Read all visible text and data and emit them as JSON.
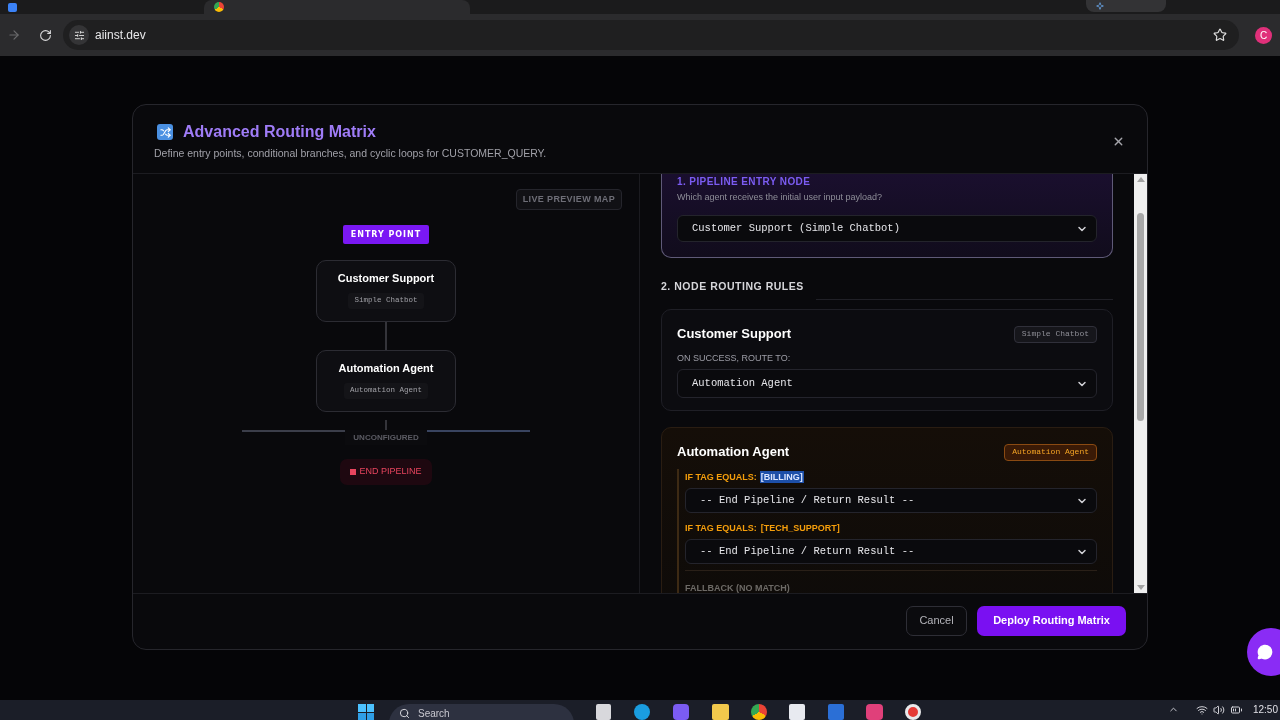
{
  "browser": {
    "url": "aiinst.dev",
    "profile_initial": "C"
  },
  "modal": {
    "title": "Advanced Routing Matrix",
    "subtitle": "Define entry points, conditional branches, and cyclic loops for CUSTOMER_QUERY.",
    "preview": {
      "badge": "LIVE PREVIEW MAP",
      "entry_label": "ENTRY POINT",
      "nodes": [
        {
          "name": "Customer Support",
          "type": "Simple Chatbot"
        },
        {
          "name": "Automation Agent",
          "type": "Automation Agent"
        }
      ],
      "branch_label": "UNCONFIGURED",
      "end_label": "END PIPELINE"
    },
    "entry_section": {
      "heading": "1. PIPELINE ENTRY NODE",
      "hint": "Which agent receives the initial user input payload?",
      "value": "Customer Support (Simple Chatbot)"
    },
    "rules_heading": "2. NODE ROUTING RULES",
    "rules": [
      {
        "kind": "success",
        "title": "Customer Support",
        "badge": "Simple Chatbot",
        "routes": [
          {
            "label": "ON SUCCESS, ROUTE TO:",
            "value": "Automation Agent"
          }
        ]
      },
      {
        "kind": "tagged",
        "title": "Automation Agent",
        "badge": "Automation Agent",
        "routes": [
          {
            "label": "IF TAG EQUALS:",
            "tag": "[BILLING]",
            "highlighted": true,
            "value": "-- End Pipeline / Return Result --"
          },
          {
            "label": "IF TAG EQUALS:",
            "tag": "[TECH_SUPPORT]",
            "highlighted": false,
            "value": "-- End Pipeline / Return Result --"
          }
        ],
        "fallback_label": "FALLBACK (NO MATCH)"
      }
    ],
    "buttons": [
      {
        "kind": "secondary",
        "label": "Cancel"
      },
      {
        "kind": "primary",
        "label": "Deploy Routing Matrix"
      }
    ]
  },
  "taskbar": {
    "search_label": "Search",
    "clock": "12:50"
  }
}
